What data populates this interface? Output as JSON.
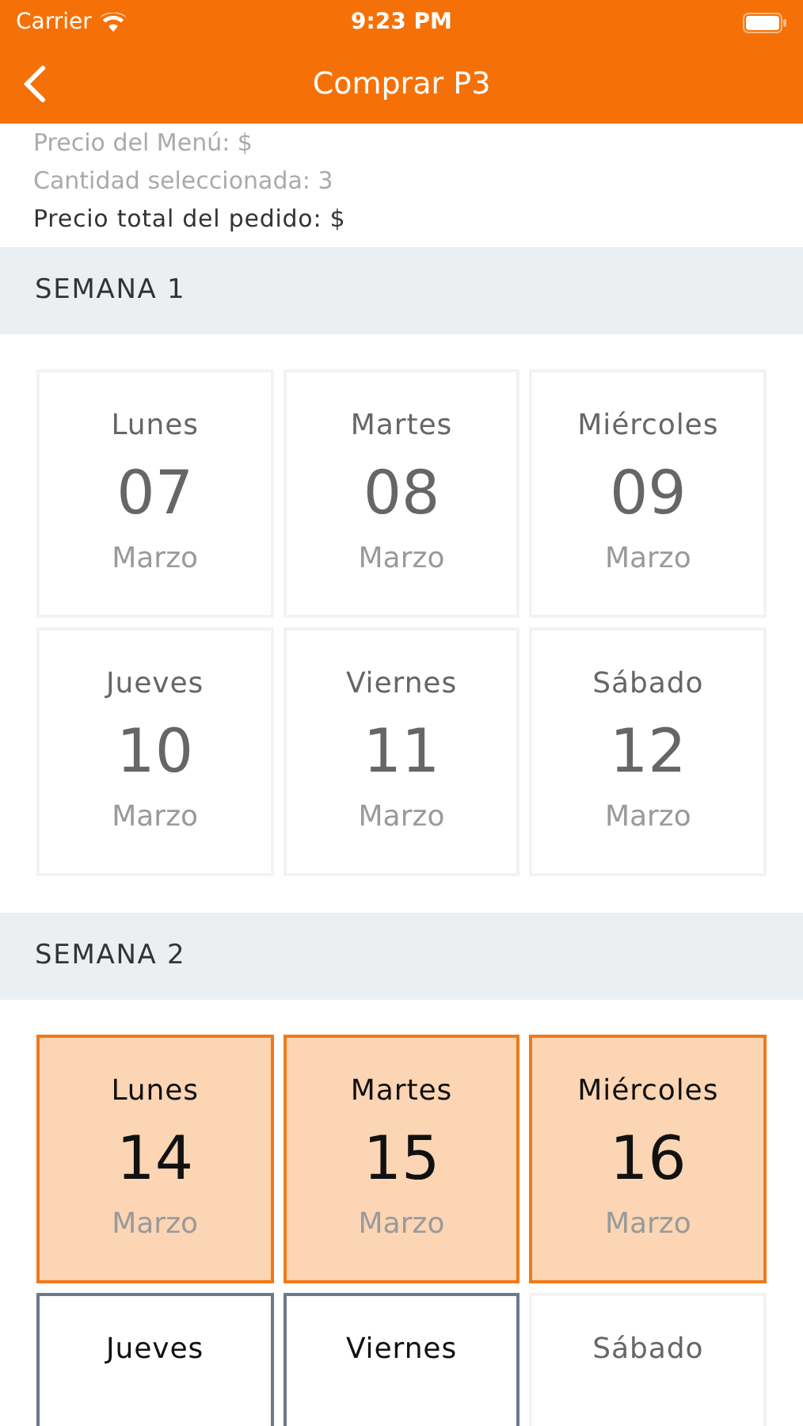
{
  "status_bar": {
    "carrier": "Carrier",
    "time": "9:23 PM"
  },
  "nav": {
    "title": "Comprar P3"
  },
  "summary": [
    {
      "text": "Precio del Menú: $",
      "emphasis": false
    },
    {
      "text": "Cantidad seleccionada: 3",
      "emphasis": false
    },
    {
      "text": "Precio total del pedido: $",
      "emphasis": true
    }
  ],
  "weeks": [
    {
      "title": "SEMANA 1",
      "days": [
        {
          "day": "Lunes",
          "number": "07",
          "month": "Marzo",
          "selected": false,
          "disabled": true
        },
        {
          "day": "Martes",
          "number": "08",
          "month": "Marzo",
          "selected": false,
          "disabled": true
        },
        {
          "day": "Miércoles",
          "number": "09",
          "month": "Marzo",
          "selected": false,
          "disabled": true
        },
        {
          "day": "Jueves",
          "number": "10",
          "month": "Marzo",
          "selected": false,
          "disabled": true
        },
        {
          "day": "Viernes",
          "number": "11",
          "month": "Marzo",
          "selected": false,
          "disabled": true
        },
        {
          "day": "Sábado",
          "number": "12",
          "month": "Marzo",
          "selected": false,
          "disabled": true
        }
      ]
    },
    {
      "title": "SEMANA 2",
      "days": [
        {
          "day": "Lunes",
          "number": "14",
          "month": "Marzo",
          "selected": true,
          "disabled": false
        },
        {
          "day": "Martes",
          "number": "15",
          "month": "Marzo",
          "selected": true,
          "disabled": false
        },
        {
          "day": "Miércoles",
          "number": "16",
          "month": "Marzo",
          "selected": true,
          "disabled": false
        },
        {
          "day": "Jueves",
          "selected": false,
          "disabled": false
        },
        {
          "day": "Viernes",
          "selected": false,
          "disabled": false
        },
        {
          "day": "Sábado",
          "selected": false,
          "disabled": true
        }
      ]
    }
  ]
}
